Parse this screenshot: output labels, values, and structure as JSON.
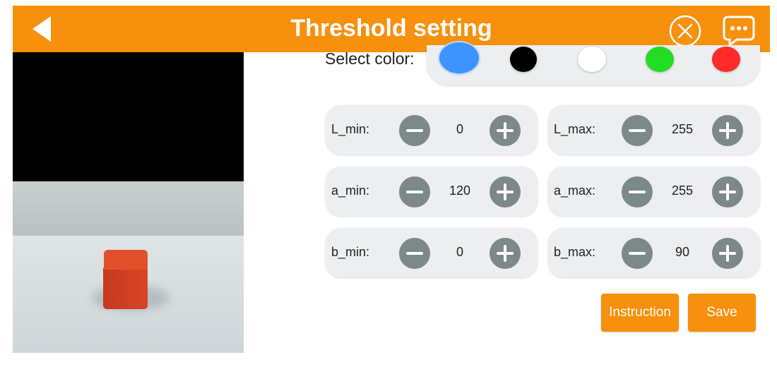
{
  "header": {
    "title": "Threshold setting",
    "back_icon": "back-arrow-icon",
    "close_icon": "close-circle-icon",
    "chat_icon": "chat-bubble-icon",
    "accent_color": "#f7900c"
  },
  "color_select": {
    "label": "Select color:",
    "selected": "blue",
    "colors": [
      {
        "name": "blue",
        "hex": "#3d93ff"
      },
      {
        "name": "black",
        "hex": "#000000"
      },
      {
        "name": "white",
        "hex": "#ffffff"
      },
      {
        "name": "green",
        "hex": "#22dd22"
      },
      {
        "name": "red",
        "hex": "#ff2a2a"
      }
    ]
  },
  "params": {
    "L_min": {
      "label": "L_min:",
      "value": "0"
    },
    "L_max": {
      "label": "L_max:",
      "value": "255"
    },
    "a_min": {
      "label": "a_min:",
      "value": "120"
    },
    "a_max": {
      "label": "a_max:",
      "value": "255"
    },
    "b_min": {
      "label": "b_min:",
      "value": "0"
    },
    "b_max": {
      "label": "b_max:",
      "value": "90"
    }
  },
  "actions": {
    "instruction_label": "Instruction",
    "save_label": "Save"
  }
}
